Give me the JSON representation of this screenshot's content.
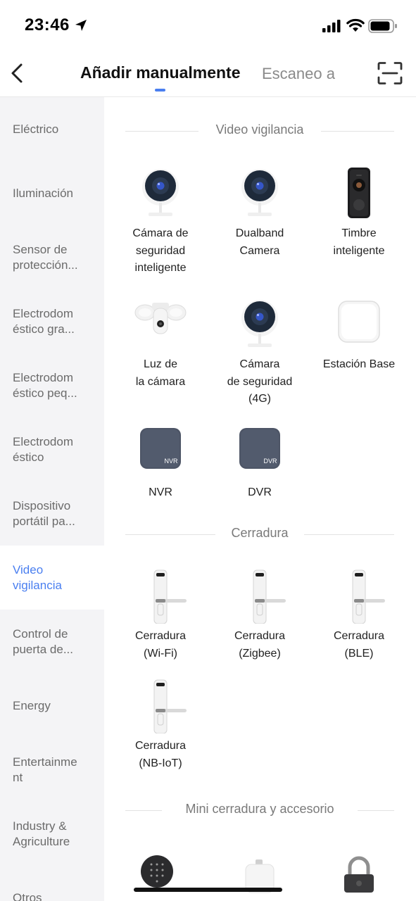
{
  "status_bar": {
    "time": "23:46"
  },
  "nav": {
    "back_label": "",
    "tab_manual": "Añadir manualmente",
    "tab_scan": "Escaneo a",
    "accent": "#4a7ff0"
  },
  "sidebar": {
    "items": [
      {
        "label": "Eléctrico"
      },
      {
        "label": "Iluminación"
      },
      {
        "label": "Sensor de\nprotección..."
      },
      {
        "label": "Electrodom\néstico gra..."
      },
      {
        "label": "Electrodom\néstico peq..."
      },
      {
        "label": "Electrodom\néstico"
      },
      {
        "label": "Dispositivo\nportátil pa..."
      },
      {
        "label": "Video\nvigilancia",
        "active": true
      },
      {
        "label": "Control de\npuerta de..."
      },
      {
        "label": "Energy"
      },
      {
        "label": "Entertainme\nnt"
      },
      {
        "label": "Industry &\nAgriculture"
      },
      {
        "label": "Otros"
      }
    ]
  },
  "sections": {
    "video": {
      "title": "Video vigilancia",
      "devices": [
        {
          "label": "Cámara de\nseguridad\ninteligente",
          "icon": "camera-icon"
        },
        {
          "label": "Dualband\nCamera",
          "icon": "camera-icon"
        },
        {
          "label": "Timbre\ninteligente",
          "icon": "doorbell-icon"
        },
        {
          "label": "Luz de\nla cámara",
          "icon": "floodlight-camera-icon"
        },
        {
          "label": "Cámara\nde seguridad\n(4G)",
          "icon": "camera-icon"
        },
        {
          "label": "Estación Base",
          "icon": "base-station-icon"
        },
        {
          "label": "NVR",
          "icon": "nvr-icon",
          "badge": "NVR"
        },
        {
          "label": "DVR",
          "icon": "dvr-icon",
          "badge": "DVR"
        }
      ]
    },
    "lock": {
      "title": "Cerradura",
      "devices": [
        {
          "label": "Cerradura\n(Wi-Fi)",
          "icon": "door-lock-icon"
        },
        {
          "label": "Cerradura\n(Zigbee)",
          "icon": "door-lock-icon"
        },
        {
          "label": "Cerradura\n(BLE)",
          "icon": "door-lock-icon"
        },
        {
          "label": "Cerradura\n(NB-IoT)",
          "icon": "door-lock-icon"
        }
      ]
    },
    "mini_lock": {
      "title": "Mini cerradura y accesorio",
      "devices": [
        {
          "label": "",
          "icon": "keypad-icon"
        },
        {
          "label": "",
          "icon": "mini-lock-icon"
        },
        {
          "label": "",
          "icon": "padlock-icon"
        }
      ]
    }
  }
}
